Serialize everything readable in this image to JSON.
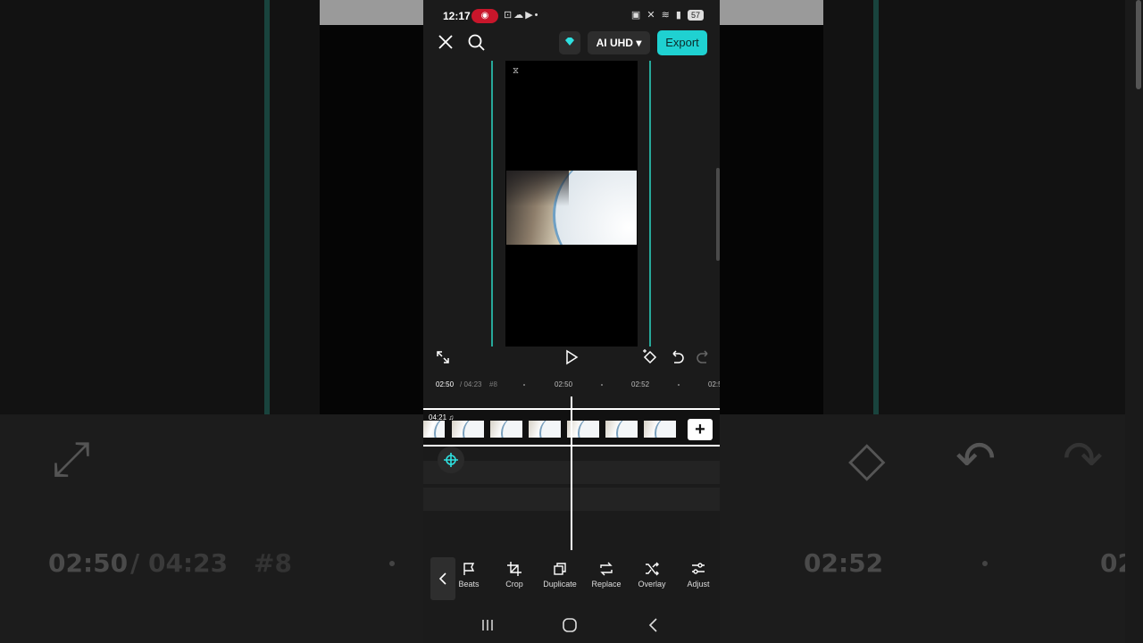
{
  "status_bar": {
    "time": "12:17",
    "recording_icon": "record-icon",
    "battery": "57"
  },
  "top_bar": {
    "quality_label": "AI UHD",
    "export_label": "Export"
  },
  "timeline": {
    "current_time": "02:50",
    "total_time": "/ 04:23",
    "ruler_marks": [
      "#8",
      "02:50",
      "02:52",
      "02:5"
    ],
    "clip_duration": "04:21"
  },
  "toolbar": {
    "tools": [
      {
        "label": "Beats",
        "icon": "flag-icon"
      },
      {
        "label": "Crop",
        "icon": "crop-icon"
      },
      {
        "label": "Duplicate",
        "icon": "duplicate-icon"
      },
      {
        "label": "Replace",
        "icon": "replace-icon"
      },
      {
        "label": "Overlay",
        "icon": "overlay-icon"
      },
      {
        "label": "Adjust",
        "icon": "adjust-icon"
      }
    ]
  },
  "colors": {
    "accent": "#1fd1d1",
    "guide": "#27a89a",
    "record": "#c8162b"
  }
}
